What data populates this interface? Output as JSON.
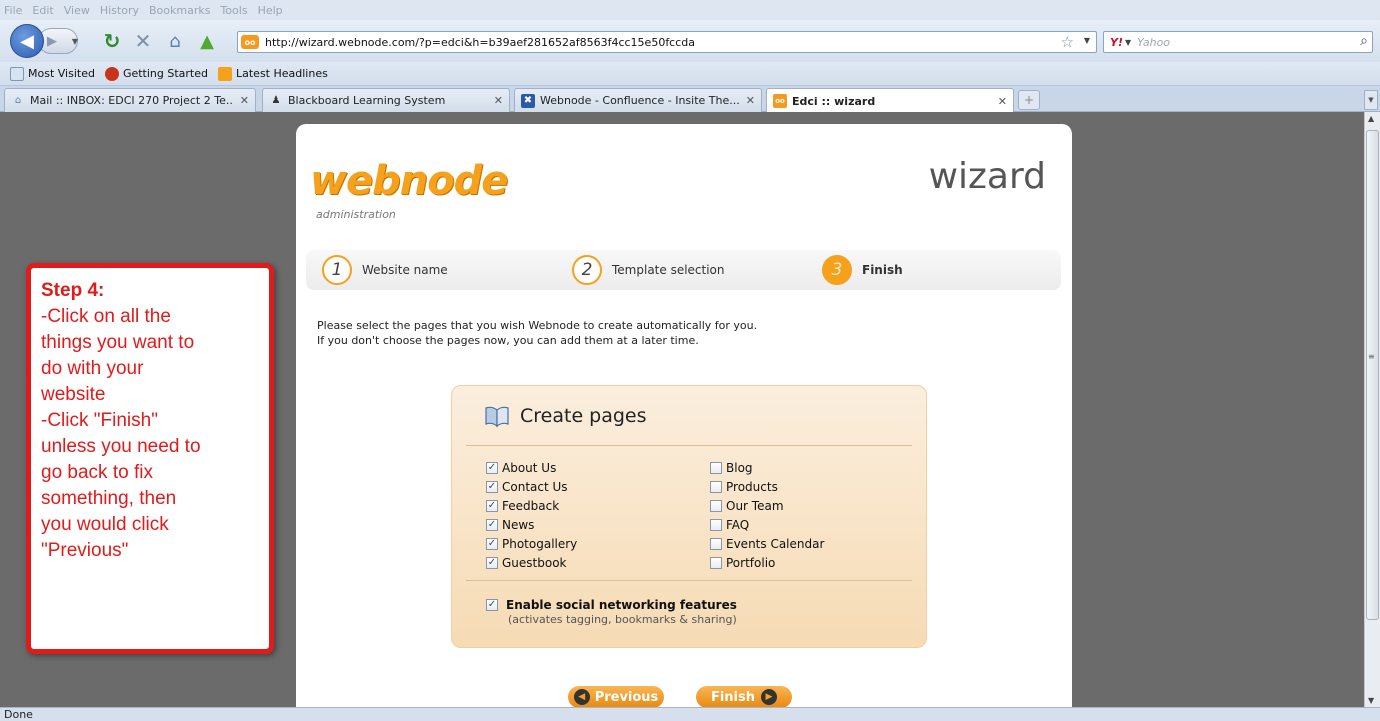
{
  "browser": {
    "menu": [
      "File",
      "Edit",
      "View",
      "History",
      "Bookmarks",
      "Tools",
      "Help"
    ],
    "url": "http://wizard.webnode.com/?p=edci&h=b39aef281652af8563f4cc15e50fccda",
    "search_engine": "Y!",
    "search_placeholder": "Yahoo",
    "bookmarks": [
      "Most Visited",
      "Getting Started",
      "Latest Headlines"
    ],
    "tabs": [
      {
        "label": "Mail :: INBOX: EDCI 270 Project 2 Te...",
        "active": false
      },
      {
        "label": "Blackboard Learning System",
        "active": false
      },
      {
        "label": "Webnode - Confluence - Insite The...",
        "active": false
      },
      {
        "label": "Edci :: wizard",
        "active": true
      }
    ],
    "status": "Done",
    "colors": {
      "accent": "#f5a11b",
      "annotation": "#e01b1b",
      "chrome": "#d4e0ee"
    }
  },
  "wizard": {
    "logo": "webnode",
    "logo_sub": "administration",
    "title": "wizard",
    "steps": [
      {
        "num": "1",
        "label": "Website name"
      },
      {
        "num": "2",
        "label": "Template selection"
      },
      {
        "num": "3",
        "label": "Finish"
      }
    ],
    "intro": [
      "Please select the pages that you wish Webnode to create automatically for you.",
      "If you don't choose the pages now, you can add them at a later time."
    ],
    "box_title": "Create pages",
    "left_pages": [
      {
        "label": "About Us",
        "checked": true
      },
      {
        "label": "Contact Us",
        "checked": true
      },
      {
        "label": "Feedback",
        "checked": true
      },
      {
        "label": "News",
        "checked": true
      },
      {
        "label": "Photogallery",
        "checked": true
      },
      {
        "label": "Guestbook",
        "checked": true
      }
    ],
    "right_pages": [
      {
        "label": "Blog",
        "checked": false
      },
      {
        "label": "Products",
        "checked": false
      },
      {
        "label": "Our Team",
        "checked": false
      },
      {
        "label": "FAQ",
        "checked": false
      },
      {
        "label": "Events Calendar",
        "checked": false
      },
      {
        "label": "Portfolio",
        "checked": false
      }
    ],
    "social": {
      "label": "Enable social networking features",
      "note": "(activates tagging, bookmarks & sharing)",
      "checked": true
    },
    "prev_label": "Previous",
    "finish_label": "Finish"
  },
  "annotation": {
    "title": "Step 4:",
    "lines": [
      "-Click on all the",
      "things you want to",
      "do with your",
      "website",
      "-Click \"Finish\"",
      "unless you need to",
      "go back to fix",
      "something, then",
      "you would click",
      "\"Previous\""
    ]
  }
}
